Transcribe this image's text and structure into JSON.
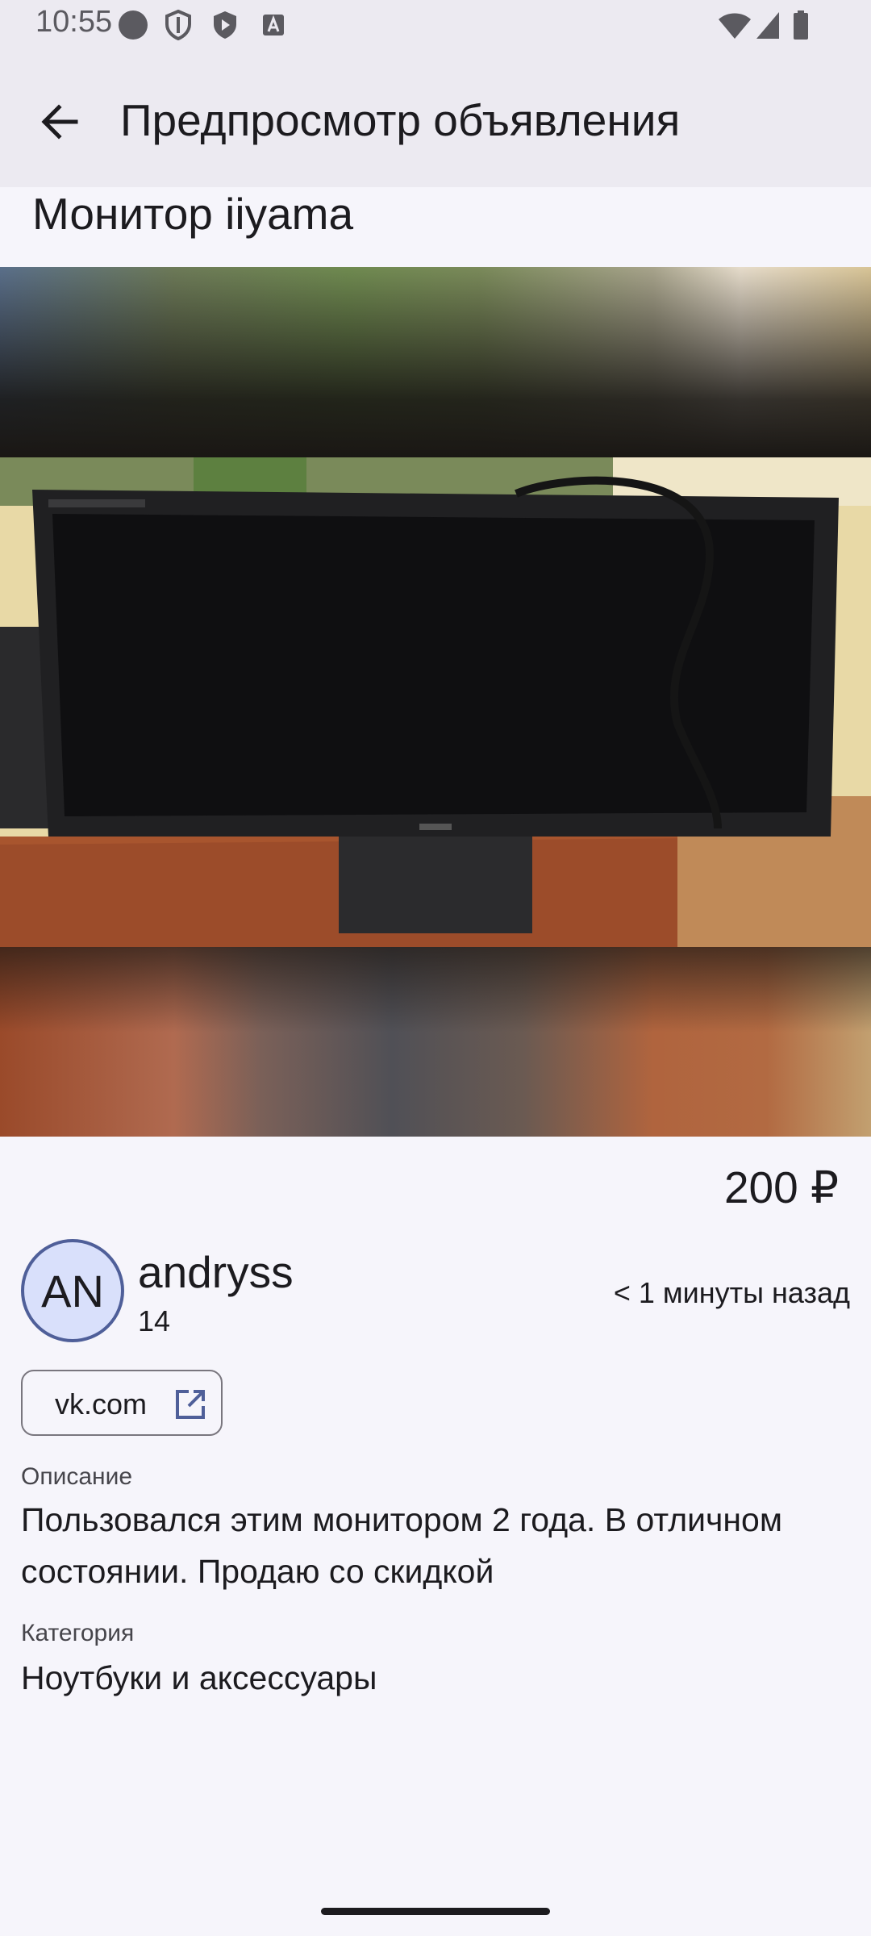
{
  "status_bar": {
    "time": "10:55",
    "icons": [
      "circle-notification-icon",
      "shield-icon",
      "play-shield-icon",
      "a-badge-icon",
      "wifi-icon",
      "signal-icon",
      "battery-icon"
    ]
  },
  "app_bar": {
    "back_icon": "arrow-back-icon",
    "title": "Предпросмотр объявления"
  },
  "listing": {
    "title": "Монитор iiyama",
    "gallery": {
      "image_count": 3,
      "selected_index": 0
    },
    "price": "200 ₽"
  },
  "seller": {
    "initials": "AN",
    "name": "andryss",
    "count": "14",
    "time_ago": "< 1 минуты назад"
  },
  "link": {
    "label": "vk.com",
    "icon": "open-in-new-icon"
  },
  "description": {
    "label": "Описание",
    "text": "Пользовался этим монитором 2 года. В отличном состоянии. Продаю со скидкой"
  },
  "category": {
    "label": "Категория",
    "text": "Ноутбуки и аксессуары"
  },
  "colors": {
    "accent": "#4f5f99",
    "background": "#f6f5fb",
    "bar": "#eceaf1",
    "avatar_bg": "#d9e0fb"
  }
}
